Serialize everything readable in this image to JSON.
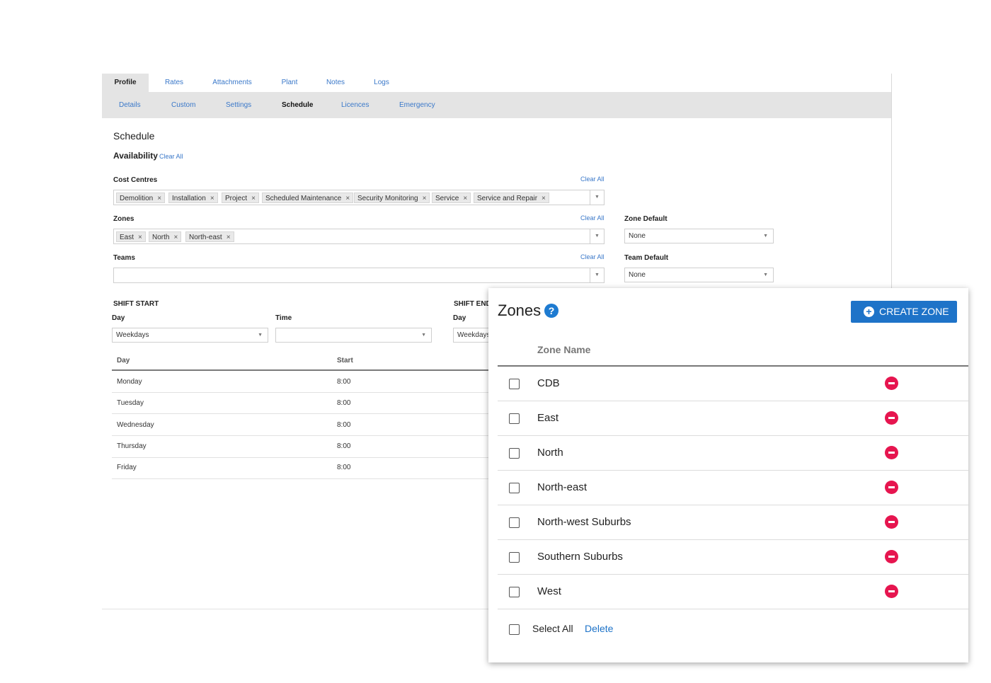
{
  "main_tabs": [
    "Profile",
    "Rates",
    "Attachments",
    "Plant",
    "Notes",
    "Logs"
  ],
  "sub_tabs": [
    "Details",
    "Custom",
    "Settings",
    "Schedule",
    "Licences",
    "Emergency"
  ],
  "schedule": {
    "title": "Schedule",
    "availability_label": "Availability",
    "availability_clear": "Clear All"
  },
  "cost_centres": {
    "label": "Cost Centres",
    "clear": "Clear All",
    "chips": [
      "Demolition",
      "Installation",
      "Project",
      "Scheduled Maintenance",
      "Security Monitoring",
      "Service",
      "Service and Repair"
    ]
  },
  "zones_field": {
    "label": "Zones",
    "clear": "Clear All",
    "chips": [
      "East",
      "North",
      "North-east"
    ]
  },
  "teams_field": {
    "label": "Teams",
    "clear": "Clear All"
  },
  "zone_default": {
    "label": "Zone Default",
    "value": "None"
  },
  "team_default": {
    "label": "Team Default",
    "value": "None"
  },
  "shift_start": {
    "label": "SHIFT START",
    "day_label": "Day",
    "day_value": "Weekdays",
    "time_label": "Time",
    "time_value": ""
  },
  "shift_end": {
    "label": "SHIFT END",
    "day_label": "Day",
    "day_value": "Weekdays"
  },
  "shift_table": {
    "headers": [
      "Day",
      "Start"
    ],
    "rows": [
      [
        "Monday",
        "8:00"
      ],
      [
        "Tuesday",
        "8:00"
      ],
      [
        "Wednesday",
        "8:00"
      ],
      [
        "Thursday",
        "8:00"
      ],
      [
        "Friday",
        "8:00"
      ]
    ]
  },
  "zones_dialog": {
    "title": "Zones",
    "help": "?",
    "create_label": "CREATE ZONE",
    "column_header": "Zone Name",
    "zones": [
      "CDB",
      "East",
      "North",
      "North-east",
      "North-west Suburbs",
      "Southern Suburbs",
      "West"
    ],
    "select_all": "Select All",
    "delete": "Delete",
    "delete_color": "#e6154f",
    "accent_color": "#1e73c8"
  }
}
